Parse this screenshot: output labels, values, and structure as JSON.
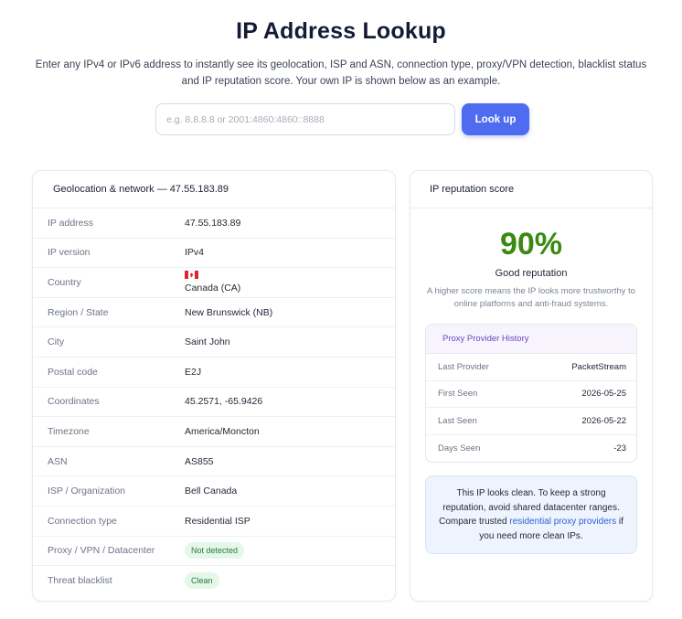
{
  "header": {
    "title": "IP Address Lookup",
    "description": "Enter any IPv4 or IPv6 address to instantly see its geolocation, ISP and ASN, connection type, proxy/VPN detection, blacklist status and IP reputation score. Your own IP is shown below as an example."
  },
  "search": {
    "placeholder": "e.g. 8.8.8.8 or 2001:4860:4860::8888",
    "value": "",
    "button_label": "Look up"
  },
  "geo": {
    "title": "Geolocation & network — 47.55.183.89",
    "rows": [
      {
        "label": "IP address",
        "value": "47.55.183.89"
      },
      {
        "label": "IP version",
        "value": "IPv4"
      },
      {
        "label": "Country",
        "value": "Canada (CA)",
        "icon": "canada-flag-icon"
      },
      {
        "label": "Region / State",
        "value": "New Brunswick (NB)"
      },
      {
        "label": "City",
        "value": "Saint John"
      },
      {
        "label": "Postal code",
        "value": "E2J"
      },
      {
        "label": "Coordinates",
        "value": "45.2571, -65.9426"
      },
      {
        "label": "Timezone",
        "value": "America/Moncton"
      },
      {
        "label": "ASN",
        "value": "AS855"
      },
      {
        "label": "ISP / Organization",
        "value": "Bell Canada"
      },
      {
        "label": "Connection type",
        "value": "Residential ISP"
      },
      {
        "label": "Proxy / VPN / Datacenter",
        "value": "Not detected"
      },
      {
        "label": "Threat blacklist",
        "value": "Clean"
      }
    ]
  },
  "reputation": {
    "title": "IP reputation score",
    "score": "90%",
    "label": "Good reputation",
    "description": "A higher score means the IP looks more trustworthy to online platforms and anti-fraud systems.",
    "score_color": "#3a8a12",
    "provider_history": {
      "title": "Proxy Provider History",
      "rows": [
        {
          "label": "Last Provider",
          "value": "PacketStream"
        },
        {
          "label": "First Seen",
          "value": "2026-05-25"
        },
        {
          "label": "Last Seen",
          "value": "2026-05-22"
        },
        {
          "label": "Days Seen",
          "value": "-23"
        }
      ]
    },
    "note": {
      "text_before": "This IP looks clean. To keep a strong reputation, avoid shared datacenter ranges. Compare trusted ",
      "link_text": "residential proxy providers",
      "text_after": " if you need more clean IPs."
    }
  },
  "colors": {
    "accent": "#4f6bf0",
    "badge_bg": "#e5f7e8",
    "badge_text": "#2a7a3d",
    "link": "#2f5fd8"
  }
}
